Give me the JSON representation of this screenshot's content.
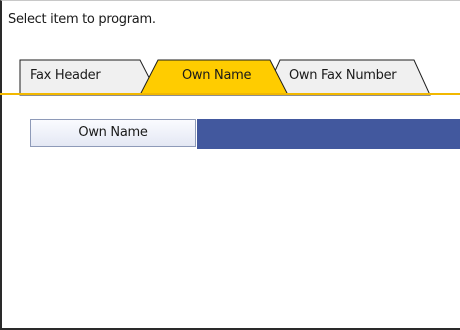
{
  "header": {
    "prompt": "Select item to program."
  },
  "tabs": [
    {
      "label": "Fax Header",
      "active": false
    },
    {
      "label": "Own Name",
      "active": true
    },
    {
      "label": "Own Fax Number",
      "active": false
    }
  ],
  "form": {
    "field_label": "Own Name",
    "field_value": ""
  },
  "colors": {
    "active_tab": "#ffcc00",
    "inactive_tab": "#f0f0f0",
    "tab_underline": "#f2b800",
    "value_field": "#42589e",
    "label_border": "#8e9ab8"
  }
}
